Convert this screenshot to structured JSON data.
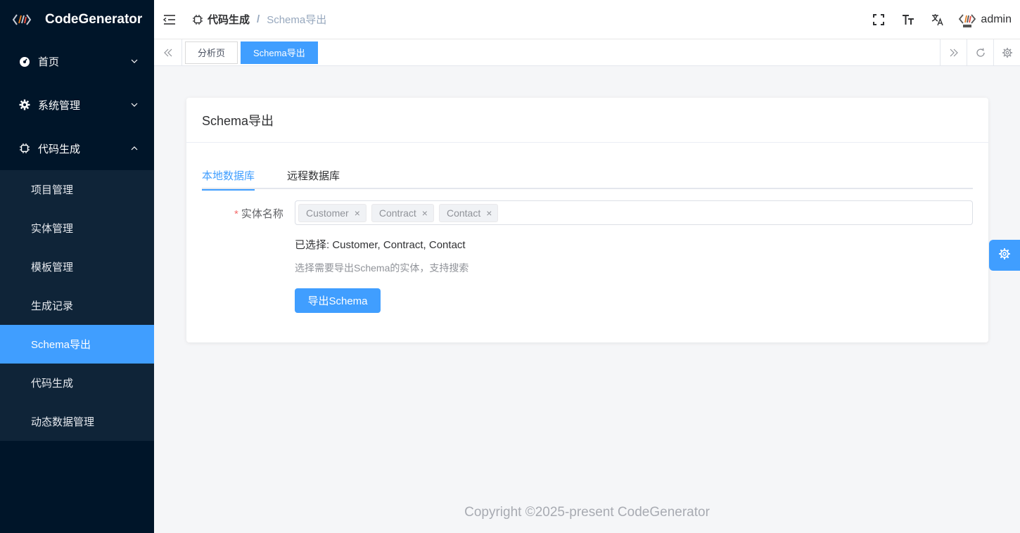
{
  "app": {
    "title": "CodeGenerator"
  },
  "sidebar": {
    "groups": [
      {
        "label": "首页",
        "icon": "dashboard-icon",
        "expanded": false
      },
      {
        "label": "系统管理",
        "icon": "gear-icon",
        "expanded": false
      },
      {
        "label": "代码生成",
        "icon": "chip-icon",
        "expanded": true
      }
    ],
    "sub_items": [
      {
        "label": "项目管理",
        "active": false
      },
      {
        "label": "实体管理",
        "active": false
      },
      {
        "label": "模板管理",
        "active": false
      },
      {
        "label": "生成记录",
        "active": false
      },
      {
        "label": "Schema导出",
        "active": true
      },
      {
        "label": "代码生成",
        "active": false
      },
      {
        "label": "动态数据管理",
        "active": false
      }
    ]
  },
  "header": {
    "breadcrumb": {
      "parent": "代码生成",
      "separator": "/",
      "current": "Schema导出"
    },
    "username": "admin"
  },
  "tags": [
    {
      "label": "分析页",
      "active": false
    },
    {
      "label": "Schema导出",
      "active": true
    }
  ],
  "card": {
    "title": "Schema导出",
    "tabs": [
      {
        "label": "本地数据库",
        "active": true
      },
      {
        "label": "远程数据库",
        "active": false
      }
    ],
    "form": {
      "required_mark": "*",
      "label": "实体名称",
      "chips": [
        "Customer",
        "Contract",
        "Contact"
      ],
      "chip_close": "×",
      "selected_text": "已选择: Customer, Contract, Contact",
      "hint": "选择需要导出Schema的实体，支持搜索",
      "button": "导出Schema"
    }
  },
  "footer": {
    "text": "Copyright ©2025-present CodeGenerator"
  },
  "colors": {
    "primary": "#409eff",
    "sidebar_bg": "#001529",
    "submenu_bg": "#0f2438"
  }
}
